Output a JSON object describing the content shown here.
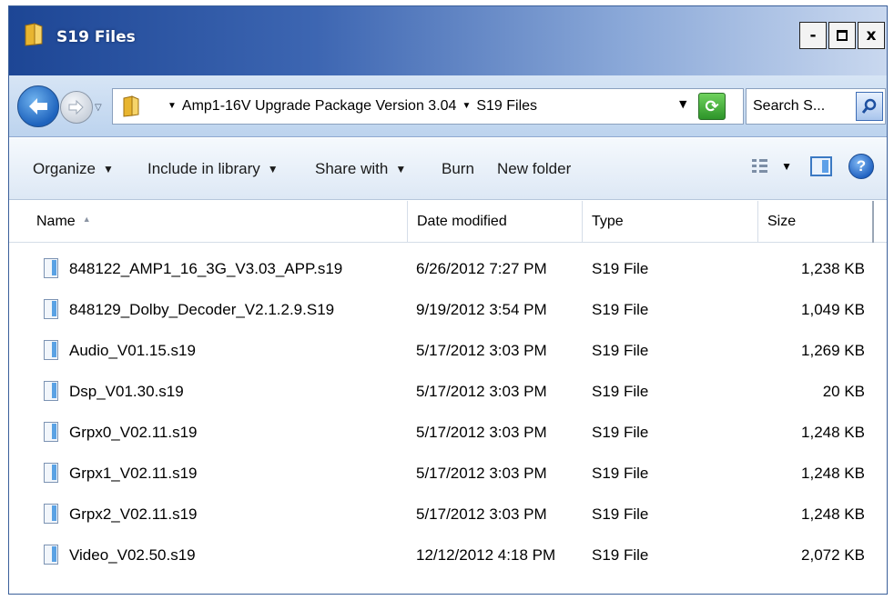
{
  "window": {
    "title": "S19 Files",
    "minimize_label": "-",
    "close_label": "x"
  },
  "nav": {
    "address_segments": [
      "Amp1-16V Upgrade Package Version 3.04",
      "S19 Files"
    ],
    "search_placeholder": "Search S..."
  },
  "toolbar": {
    "organize": "Organize",
    "include_in_library": "Include in library",
    "share_with": "Share with",
    "burn": "Burn",
    "new_folder": "New folder"
  },
  "columns": {
    "name": "Name",
    "date_modified": "Date modified",
    "type": "Type",
    "size": "Size"
  },
  "files": [
    {
      "name": "848122_AMP1_16_3G_V3.03_APP.s19",
      "date": "6/26/2012 7:27 PM",
      "type": "S19 File",
      "size": "1,238 KB"
    },
    {
      "name": "848129_Dolby_Decoder_V2.1.2.9.S19",
      "date": "9/19/2012 3:54 PM",
      "type": "S19 File",
      "size": "1,049 KB"
    },
    {
      "name": "Audio_V01.15.s19",
      "date": "5/17/2012 3:03 PM",
      "type": "S19 File",
      "size": "1,269 KB"
    },
    {
      "name": "Dsp_V01.30.s19",
      "date": "5/17/2012 3:03 PM",
      "type": "S19 File",
      "size": "20 KB"
    },
    {
      "name": "Grpx0_V02.11.s19",
      "date": "5/17/2012 3:03 PM",
      "type": "S19 File",
      "size": "1,248 KB"
    },
    {
      "name": "Grpx1_V02.11.s19",
      "date": "5/17/2012 3:03 PM",
      "type": "S19 File",
      "size": "1,248 KB"
    },
    {
      "name": "Grpx2_V02.11.s19",
      "date": "5/17/2012 3:03 PM",
      "type": "S19 File",
      "size": "1,248 KB"
    },
    {
      "name": "Video_V02.50.s19",
      "date": "12/12/2012 4:18 PM",
      "type": "S19 File",
      "size": "2,072 KB"
    }
  ]
}
